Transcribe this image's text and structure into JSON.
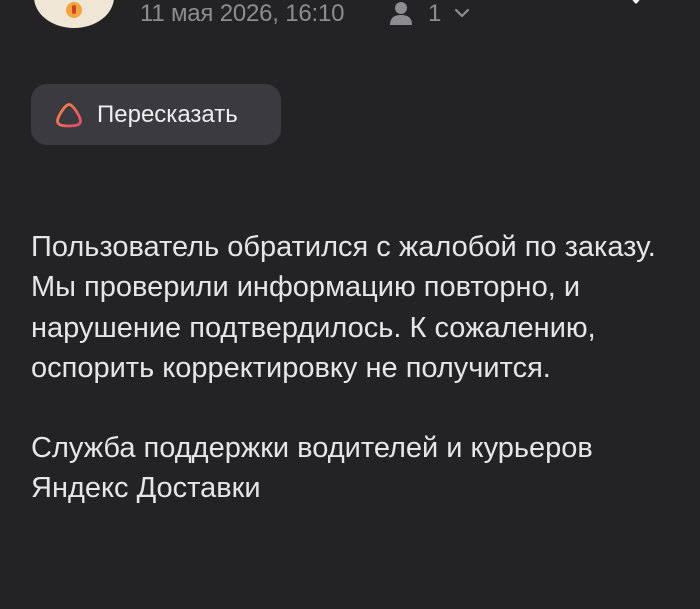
{
  "header": {
    "date": "11 мая 2026,  16:10",
    "recipient_count": "1",
    "icons": {
      "avatar": "yandex-delivery-logo",
      "recipients": "person-icon",
      "expand": "chevron-down-icon",
      "close": "close-icon"
    }
  },
  "actions": {
    "summarize_label": "Пересказать",
    "summarize_icon": "alice-icon"
  },
  "message": {
    "paragraph_1": "Пользователь обратился с жалобой по заказу. Мы проверили информацию повторно, и нарушение подтвердилось. К сожалению, оспорить корректировку не получится.",
    "paragraph_2": "Служба поддержки водителей и курьеров Яндекс Доставки"
  },
  "colors": {
    "background": "#232225",
    "button_background": "#3b3a3e",
    "muted_text": "#8d8c90",
    "body_text": "#e6e6e8",
    "alice_gradient_start": "#ff7a3d",
    "alice_gradient_end": "#c24dff"
  }
}
